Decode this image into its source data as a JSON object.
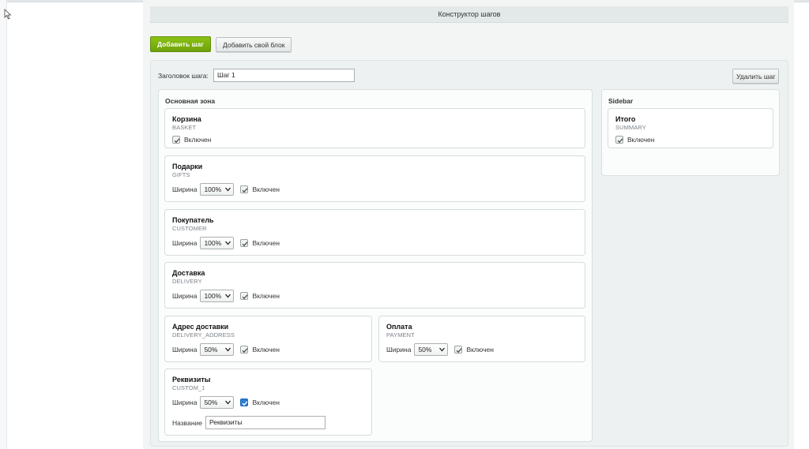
{
  "header": {
    "title": "Конструктор шагов"
  },
  "toolbar": {
    "add_step": "Добавить шаг",
    "add_own_block": "Добавить свой блок"
  },
  "step": {
    "title_label": "Заголовок шага:",
    "title_value": "Шаг 1",
    "delete_label": "Удалить шаг"
  },
  "zones": {
    "main": {
      "title": "Основная зона",
      "blocks": [
        {
          "title": "Корзина",
          "code": "BASKET",
          "enabled_label": "Включен",
          "enabled": true
        },
        {
          "title": "Подарки",
          "code": "GIFTS",
          "width_label": "Ширина",
          "width": "100%",
          "enabled_label": "Включен",
          "enabled": true
        },
        {
          "title": "Покупатель",
          "code": "CUSTOMER",
          "width_label": "Ширина",
          "width": "100%",
          "enabled_label": "Включен",
          "enabled": true
        },
        {
          "title": "Доставка",
          "code": "DELIVERY",
          "width_label": "Ширина",
          "width": "100%",
          "enabled_label": "Включен",
          "enabled": true
        },
        {
          "title": "Адрес доставки",
          "code": "DELIVERY_ADDRESS",
          "width_label": "Ширина",
          "width": "50%",
          "enabled_label": "Включен",
          "enabled": true
        },
        {
          "title": "Оплата",
          "code": "PAYMENT",
          "width_label": "Ширина",
          "width": "50%",
          "enabled_label": "Включен",
          "enabled": true
        },
        {
          "title": "Реквизиты",
          "code": "CUSTOM_1",
          "width_label": "Ширина",
          "width": "50%",
          "enabled_label": "Включен",
          "enabled": true,
          "name_label": "Название",
          "name_value": "Реквизиты"
        }
      ]
    },
    "sidebar": {
      "title": "Sidebar",
      "blocks": [
        {
          "title": "Итого",
          "code": "SUMMARY",
          "enabled_label": "Включен",
          "enabled": true
        }
      ]
    }
  },
  "colors": {
    "accent_green": "#7cb30f",
    "checkbox_blue": "#2d7fd6"
  }
}
